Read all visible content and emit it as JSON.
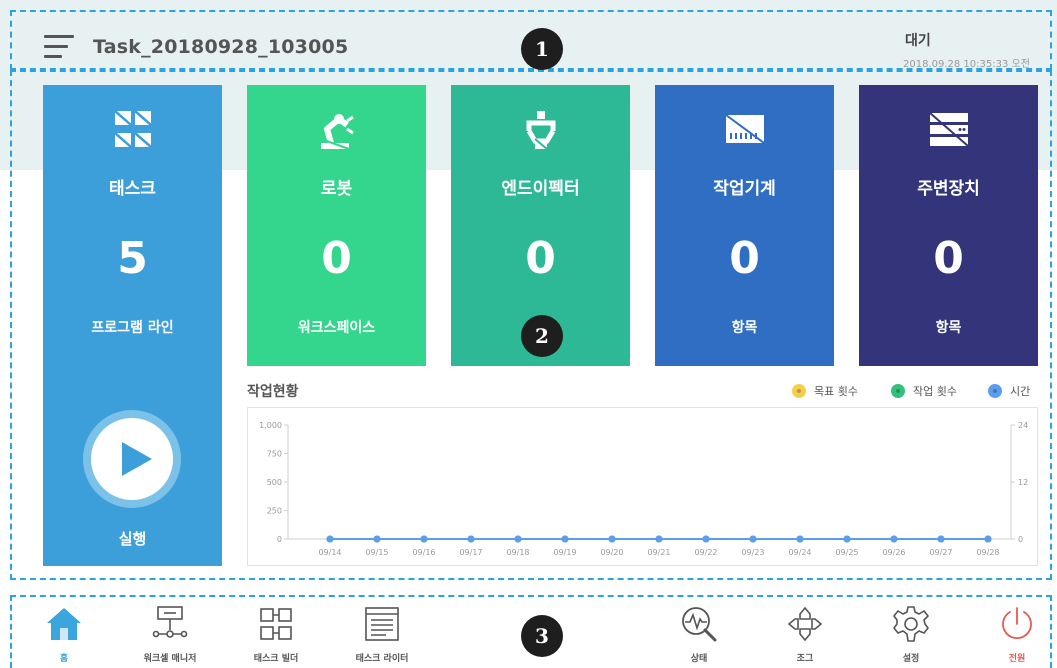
{
  "header": {
    "task_name": "Task_20180928_103005",
    "status": "대기",
    "datetime": "2018.09.28 10:35:33 오전"
  },
  "markers": [
    "1",
    "2",
    "3"
  ],
  "tiles": [
    {
      "label": "태스크",
      "count": "5",
      "unit": "프로그램 라인",
      "icon": "task-icon",
      "color": "#3d9fd9",
      "action": "실행"
    },
    {
      "label": "로봇",
      "count": "0",
      "unit": "워크스페이스",
      "icon": "robot-arm-icon",
      "color": "#33d68c"
    },
    {
      "label": "엔드이펙터",
      "count": "0",
      "unit": "",
      "icon": "gripper-icon",
      "color": "#2eb996"
    },
    {
      "label": "작업기계",
      "count": "0",
      "unit": "항목",
      "icon": "machine-icon",
      "color": "#2f6ec3"
    },
    {
      "label": "주변장치",
      "count": "0",
      "unit": "항목",
      "icon": "server-icon",
      "color": "#33347a"
    }
  ],
  "chart": {
    "title": "작업현황",
    "legend": [
      {
        "label": "목표 횟수",
        "color": "#f6cf4a"
      },
      {
        "label": "작업 횟수",
        "color": "#33c07a"
      },
      {
        "label": "시간",
        "color": "#5b9ef0"
      }
    ]
  },
  "chart_data": {
    "type": "line",
    "title": "작업현황",
    "categories": [
      "09/14",
      "09/15",
      "09/16",
      "09/17",
      "09/18",
      "09/19",
      "09/20",
      "09/21",
      "09/22",
      "09/23",
      "09/24",
      "09/25",
      "09/26",
      "09/27",
      "09/28"
    ],
    "y_left_ticks": [
      "1,000",
      "750",
      "500",
      "250",
      "0"
    ],
    "y_right_ticks": [
      "24",
      "12",
      "0"
    ],
    "ylim_left": [
      0,
      1000
    ],
    "ylim_right": [
      0,
      24
    ],
    "series": [
      {
        "name": "목표 횟수",
        "axis": "left",
        "values": [
          0,
          0,
          0,
          0,
          0,
          0,
          0,
          0,
          0,
          0,
          0,
          0,
          0,
          0,
          0
        ]
      },
      {
        "name": "작업 횟수",
        "axis": "left",
        "values": [
          0,
          0,
          0,
          0,
          0,
          0,
          0,
          0,
          0,
          0,
          0,
          0,
          0,
          0,
          0
        ]
      },
      {
        "name": "시간",
        "axis": "right",
        "values": [
          0,
          0,
          0,
          0,
          0,
          0,
          0,
          0,
          0,
          0,
          0,
          0,
          0,
          0,
          0
        ]
      }
    ],
    "grid": false
  },
  "nav": {
    "left": [
      {
        "label": "홈",
        "icon": "home-icon",
        "active": true
      },
      {
        "label": "워크셀 매니저",
        "icon": "workcell-icon"
      },
      {
        "label": "태스크 빌더",
        "icon": "task-builder-icon"
      },
      {
        "label": "태스크 라이터",
        "icon": "task-writer-icon"
      }
    ],
    "right": [
      {
        "label": "상태",
        "icon": "status-icon"
      },
      {
        "label": "조그",
        "icon": "jog-icon"
      },
      {
        "label": "설정",
        "icon": "gear-icon"
      },
      {
        "label": "전원",
        "icon": "power-icon"
      }
    ],
    "active_color": "#3aa6dd",
    "power_color": "#e35b50"
  }
}
